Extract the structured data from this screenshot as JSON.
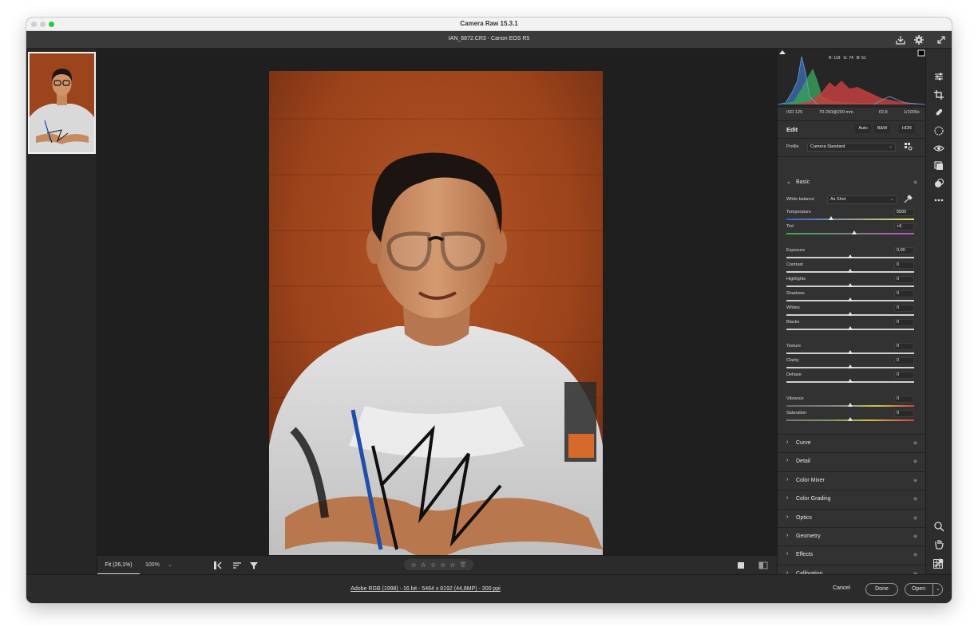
{
  "window": {
    "title": "Camera Raw 15.3.1"
  },
  "header": {
    "file_label": "IAN_6872.CR3  -  Canon EOS R5"
  },
  "canvas_toolbar": {
    "fit_label": "Fit (26,1%)",
    "zoom_label": "100%",
    "zoom_chevron": "⌄",
    "stars": [
      "☆",
      "☆",
      "☆",
      "☆",
      "☆"
    ],
    "trash": "🗑"
  },
  "status": {
    "info": "Adobe RGB (1998) - 16 bit - 5464 x 8192 (44,8MP) - 300 ppi",
    "cancel": "Cancel",
    "done": "Done",
    "open": "Open",
    "open_chevron": "⌄"
  },
  "histogram": {
    "r": "R: 119",
    "g": "G: 74",
    "b": "B: 51",
    "iso": "ISO 125",
    "lens": "70-200@200 mm",
    "aperture": "f/2,8",
    "shutter": "1/1000s"
  },
  "edit": {
    "label": "Edit",
    "auto": "Auto",
    "bw": "B&W",
    "hdr": "HDR"
  },
  "profile": {
    "label": "Profile",
    "value": "Camera Standard"
  },
  "basic": {
    "title": "Basic",
    "wb_label": "White balance",
    "wb_value": "As Shot",
    "temperature": {
      "label": "Temperature",
      "value": "5500",
      "level": 0.35
    },
    "tint": {
      "label": "Tint",
      "value": "+6",
      "level": 0.53
    },
    "tone": [
      {
        "label": "Exposure",
        "value": "0,00",
        "level": 0.5
      },
      {
        "label": "Contrast",
        "value": "0",
        "level": 0.5
      },
      {
        "label": "Highlights",
        "value": "0",
        "level": 0.5
      },
      {
        "label": "Shadows",
        "value": "0",
        "level": 0.5
      },
      {
        "label": "Whites",
        "value": "0",
        "level": 0.5
      },
      {
        "label": "Blacks",
        "value": "0",
        "level": 0.5
      }
    ],
    "presence": [
      {
        "label": "Texture",
        "value": "0",
        "level": 0.5
      },
      {
        "label": "Clarity",
        "value": "0",
        "level": 0.5
      },
      {
        "label": "Dehaze",
        "value": "0",
        "level": 0.5
      }
    ],
    "color": [
      {
        "label": "Vibrance",
        "value": "0",
        "level": 0.5
      },
      {
        "label": "Saturation",
        "value": "0",
        "level": 0.5
      }
    ]
  },
  "sections": [
    "Curve",
    "Detail",
    "Color Mixer",
    "Color Grading",
    "Optics",
    "Geometry",
    "Effects",
    "Calibration"
  ],
  "twisty_closed": "›",
  "twisty_open": "⌄",
  "eye_glyph": "◉",
  "colors": {
    "accent": "#27c93f",
    "panel": "#323232",
    "canvas": "#1f1f1f",
    "brick": "#a4471e"
  }
}
